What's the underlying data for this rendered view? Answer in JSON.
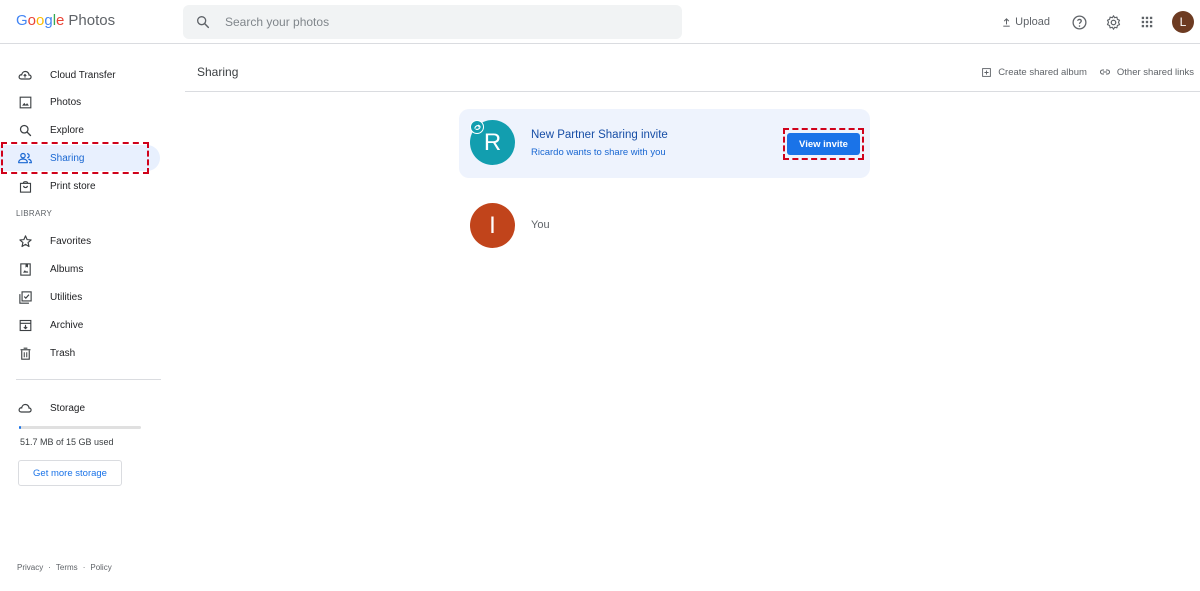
{
  "app": {
    "logo_word": "Google",
    "logo_letters": [
      "G",
      "o",
      "o",
      "g",
      "l",
      "e"
    ],
    "logo_colors": [
      "#4285f4",
      "#ea4335",
      "#fbbc05",
      "#4285f4",
      "#34a853",
      "#ea4335"
    ],
    "product": "Photos"
  },
  "search": {
    "placeholder": "Search your photos",
    "icon": "search-icon"
  },
  "header_actions": {
    "upload_label": "Upload",
    "help_icon": "help-icon",
    "settings_icon": "gear-icon",
    "apps_icon": "apps-grid-icon",
    "avatar_letter": "L"
  },
  "sidebar": {
    "items": [
      {
        "label": "Cloud Transfer",
        "icon": "cloud-upload-icon"
      },
      {
        "label": "Photos",
        "icon": "photo-icon"
      },
      {
        "label": "Explore",
        "icon": "search-icon"
      },
      {
        "label": "Sharing",
        "icon": "people-icon",
        "active": true
      },
      {
        "label": "Print store",
        "icon": "shopping-bag-icon"
      }
    ],
    "library_label": "LIBRARY",
    "library_items": [
      {
        "label": "Favorites",
        "icon": "star-icon"
      },
      {
        "label": "Albums",
        "icon": "album-icon"
      },
      {
        "label": "Utilities",
        "icon": "checklist-icon"
      },
      {
        "label": "Archive",
        "icon": "archive-icon"
      },
      {
        "label": "Trash",
        "icon": "trash-icon"
      }
    ],
    "storage": {
      "label": "Storage",
      "icon": "cloud-icon",
      "used_text": "51.7 MB of 15 GB used",
      "used_fraction": 0.0034,
      "more_button": "Get more storage"
    },
    "footer": {
      "privacy": "Privacy",
      "terms": "Terms",
      "policy": "Policy",
      "separator": "·"
    }
  },
  "main": {
    "title": "Sharing",
    "actions": {
      "create_album": "Create shared album",
      "other_links": "Other shared links"
    },
    "invite": {
      "avatar_letter": "R",
      "title": "New Partner Sharing invite",
      "subtitle": "Ricardo wants to share with you",
      "button": "View invite"
    },
    "you": {
      "avatar_letter": "I",
      "label": "You"
    }
  },
  "colors": {
    "accent": "#1a73e8",
    "active_bg": "#e8f0fe",
    "invite_card_bg": "#eef3fd",
    "partner_avatar": "#129eaf",
    "you_avatar": "#c1441b",
    "user_avatar": "#6d3b22",
    "highlight": "#d0021b"
  }
}
